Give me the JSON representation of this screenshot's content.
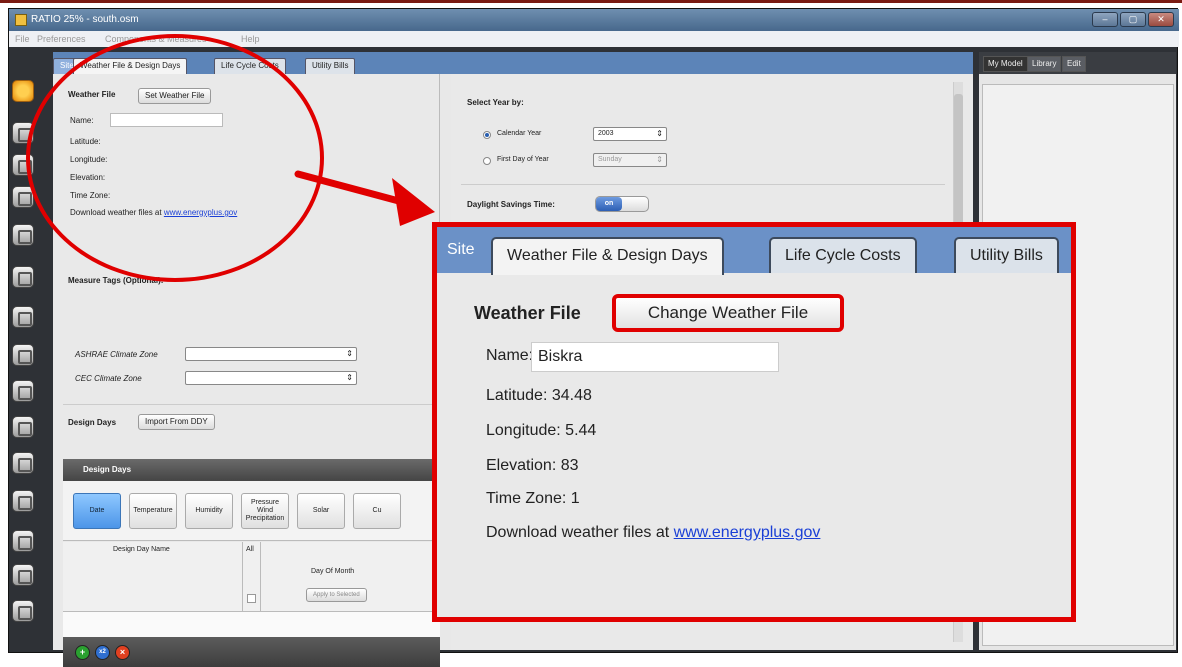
{
  "window": {
    "title": "RATIO 25% - south.osm"
  },
  "menu": [
    "File",
    "Preferences",
    "Components & Measures",
    "Help"
  ],
  "tabs": {
    "site": "Site",
    "weather": "Weather File & Design Days",
    "lcc": "Life Cycle Costs",
    "bills": "Utility Bills"
  },
  "weather": {
    "heading": "Weather File",
    "set_button": "Set Weather File",
    "name_label": "Name:",
    "latitude_label": "Latitude:",
    "longitude_label": "Longitude:",
    "elevation_label": "Elevation:",
    "timezone_label": "Time Zone:",
    "download_text": "Download weather files at",
    "download_link": "www.energyplus.gov"
  },
  "year": {
    "heading": "Select Year by:",
    "calendar_label": "Calendar Year",
    "calendar_value": "2003",
    "first_day_label": "First Day of Year",
    "first_day_value": "Sunday",
    "dst_label": "Daylight Savings Time:",
    "dst_value": "on"
  },
  "measure_tags": {
    "heading": "Measure Tags (Optional):",
    "ashrae_label": "ASHRAE Climate Zone",
    "cec_label": "CEC Climate Zone"
  },
  "design_days": {
    "label": "Design Days",
    "import_button": "Import From DDY",
    "panel_title": "Design Days",
    "buttons": [
      "Date",
      "Temperature",
      "Humidity",
      "Pressure\nWind\nPrecipitation",
      "Solar",
      "Cu"
    ],
    "col_name": "Design Day Name",
    "col_all": "All",
    "col_day": "Day Of Month",
    "apply_button": "Apply to Selected"
  },
  "inspector": {
    "tabs": [
      "My Model",
      "Library",
      "Edit"
    ]
  },
  "zoom": {
    "site": "Site",
    "tab_weather": "Weather File & Design Days",
    "tab_lcc": "Life Cycle Costs",
    "tab_bills": "Utility Bills",
    "heading": "Weather File",
    "change_button": "Change Weather File",
    "name_label": "Name:",
    "name_value": "Biskra",
    "latitude": "Latitude: 34.48",
    "longitude": "Longitude: 5.44",
    "elevation": "Elevation: 83",
    "timezone": "Time Zone: 1",
    "download_text": "Download weather files at",
    "download_link": "www.energyplus.gov"
  },
  "colors": {
    "annotation": "#e00000",
    "tab_blue": "#5c84b8",
    "link": "#1a3fd6"
  }
}
